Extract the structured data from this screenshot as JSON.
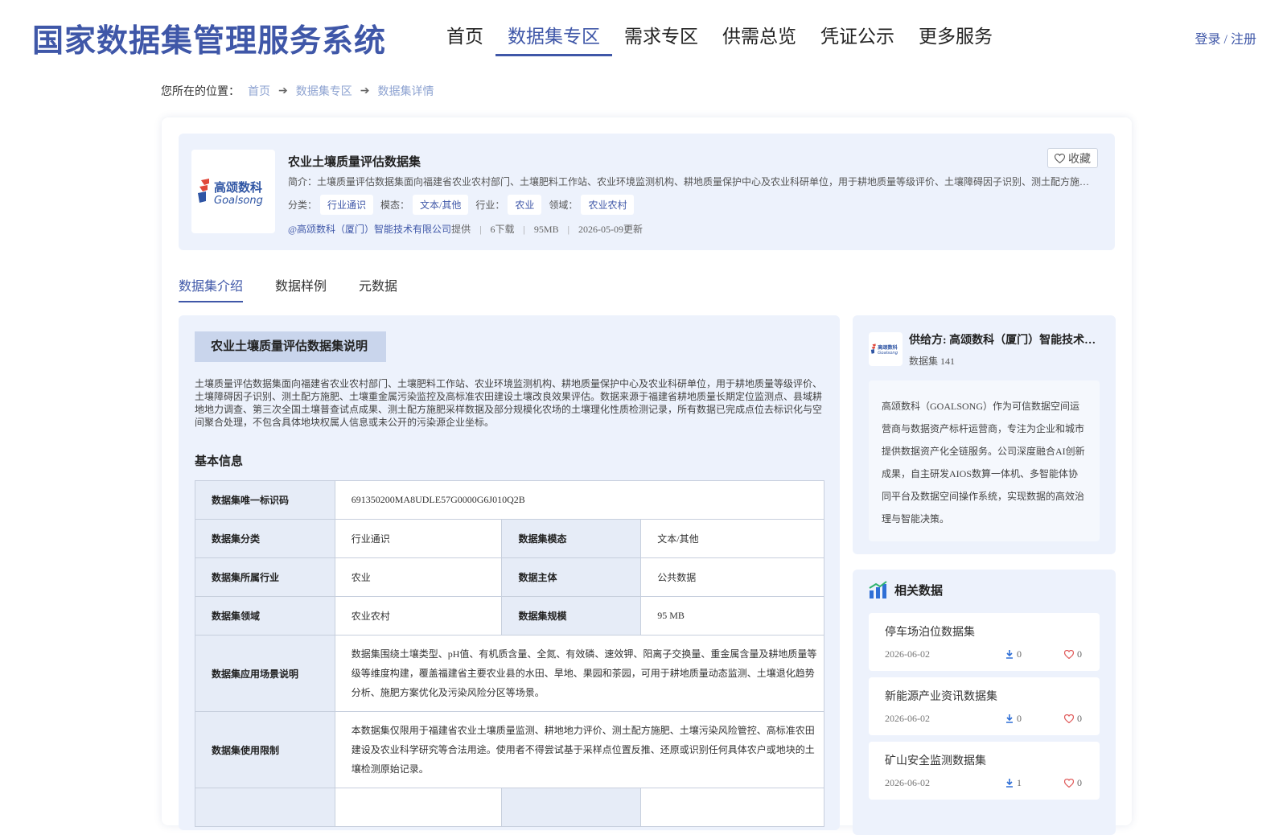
{
  "header": {
    "brand": "国家数据集管理服务系统",
    "nav": [
      "首页",
      "数据集专区",
      "需求专区",
      "供需总览",
      "凭证公示",
      "更多服务"
    ],
    "login": "登录 / 注册"
  },
  "breadcrumb": {
    "prefix": "您所在的位置：",
    "items": [
      "首页",
      "数据集专区",
      "数据集详情"
    ]
  },
  "dataset": {
    "logo_text": "高颂数科",
    "logo_sub": "Goalsong",
    "title": "农业土壤质量评估数据集",
    "desc": "简介：土壤质量评估数据集面向福建省农业农村部门、土壤肥料工作站、农业环境监测机构、耕地质量保护中心及农业科研单位，用于耕地质量等级评价、土壤障碍因子识别、测土配方施肥、土壤重金属污染监控及高标准农田建设土壤改良效果评估。",
    "tags": [
      {
        "label": "分类：",
        "value": "行业通识"
      },
      {
        "label": "模态：",
        "value": "文本/其他"
      },
      {
        "label": "行业：",
        "value": "农业"
      },
      {
        "label": "领域：",
        "value": "农业农村"
      }
    ],
    "provider": "@高颂数科（厦门）智能技术有限公司",
    "provider_suffix": "提供",
    "downloads": "6下载",
    "size": "95MB",
    "updated": "2026-05-09更新",
    "fav_label": "收藏"
  },
  "tabs": [
    "数据集介绍",
    "数据样例",
    "元数据"
  ],
  "intro": {
    "title": "农业土壤质量评估数据集说明",
    "text": "土壤质量评估数据集面向福建省农业农村部门、土壤肥料工作站、农业环境监测机构、耕地质量保护中心及农业科研单位，用于耕地质量等级评价、土壤障碍因子识别、测土配方施肥、土壤重金属污染监控及高标准农田建设土壤改良效果评估。数据来源于福建省耕地质量长期定位监测点、县域耕地地力调查、第三次全国土壤普查试点成果、测土配方施肥采样数据及部分规模化农场的土壤理化性质检测记录，所有数据已完成点位去标识化与空间聚合处理，不包含具体地块权属人信息或未公开的污染源企业坐标。",
    "basic_title": "基本信息"
  },
  "info": {
    "id_label": "数据集唯一标识码",
    "id_value": "691350200MA8UDLE57G0000G6J010Q2B",
    "cat_label": "数据集分类",
    "cat_value": "行业通识",
    "mod_label": "数据集模态",
    "mod_value": "文本/其他",
    "ind_label": "数据集所属行业",
    "ind_value": "农业",
    "sub_label": "数据主体",
    "sub_value": "公共数据",
    "dom_label": "数据集领域",
    "dom_value": "农业农村",
    "scale_label": "数据集规模",
    "scale_value": "95 MB",
    "scene_label": "数据集应用场景说明",
    "scene_value": "数据集围绕土壤类型、pH值、有机质含量、全氮、有效磷、速效钾、阳离子交换量、重金属含量及耕地质量等级等维度构建，覆盖福建省主要农业县的水田、旱地、果园和茶园，可用于耕地质量动态监测、土壤退化趋势分析、施肥方案优化及污染风险分区等场景。",
    "limit_label": "数据集使用限制",
    "limit_value": "本数据集仅限用于福建省农业土壤质量监测、耕地地力评价、测土配方施肥、土壤污染风险管控、高标准农田建设及农业科学研究等合法用途。使用者不得尝试基于采样点位置反推、还原或识别任何具体农户或地块的土壤检测原始记录。"
  },
  "supplier": {
    "name": "供给方: 高颂数科（厦门）智能技术有限公司",
    "count": "数据集 141",
    "desc": "高颂数科（GOALSONG）作为可信数据空间运营商与数据资产标杆运营商，专注为企业和城市提供数据资产化全链服务。公司深度融合AI创新成果，自主研发AIOS数算一体机、多智能体协同平台及数据空间操作系统，实现数据的高效治理与智能决策。"
  },
  "related": {
    "title": "相关数据",
    "items": [
      {
        "name": "停车场泊位数据集",
        "date": "2026-06-02",
        "downloads": "0",
        "favs": "0"
      },
      {
        "name": "新能源产业资讯数据集",
        "date": "2026-06-02",
        "downloads": "0",
        "favs": "0"
      },
      {
        "name": "矿山安全监测数据集",
        "date": "2026-06-02",
        "downloads": "1",
        "favs": "0"
      }
    ]
  },
  "colors": {
    "brand": "#3f57a8",
    "panel": "#edf2fc",
    "fav": "#e05a5a"
  }
}
